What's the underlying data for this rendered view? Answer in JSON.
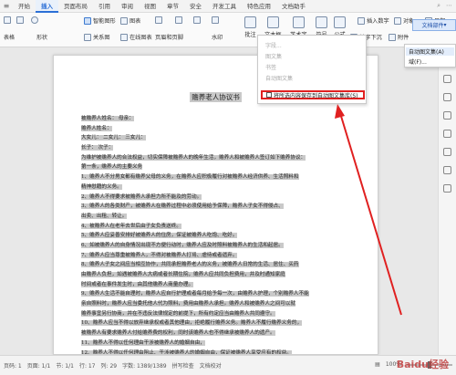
{
  "tabs": [
    "开始",
    "插入",
    "页面布局",
    "引用",
    "审阅",
    "视图",
    "章节",
    "安全",
    "开发工具",
    "特色应用",
    "文档助手"
  ],
  "active_tab_index": 1,
  "ribbon": {
    "row1": [
      "智能图形",
      "图表",
      "页眉页脚",
      "页码",
      "文本框",
      "艺术字",
      "插入数字",
      "对象",
      "日期"
    ],
    "row2": [
      "关系图",
      "在线图表",
      "页眉和页脚",
      "水印",
      "文本框",
      "首字下沉",
      "附件",
      "文档部件"
    ],
    "tall": [
      "批注",
      "文本框",
      "艺术字",
      "符号",
      "公式"
    ],
    "doc_parts_button": "文档部件"
  },
  "dropdown": {
    "items": [
      "字段...",
      "图文集",
      "书签",
      "自动图文集"
    ],
    "save_selection": "将所选内容保存到自动图文集库(S)"
  },
  "submenu": {
    "items": [
      "自动图文集(A)",
      "域(F)..."
    ]
  },
  "document": {
    "title": "赡养老人协议书",
    "lines": [
      "被赡养人姓名：  母亲：",
      "赡养人姓名：",
      "    大女儿：  二女儿：  三女儿：",
      "    长子：    次子：",
      "    为维护被赡养人的合法权益，切实保障被赡养人的晚年生活，赡养人和被赡养人签订如下赡养协议：",
      "    第一条，赡养人的主要义务",
      "    1、赡养人不分男女都有赡养父母的义务，在赡养人应积极履行对被赡养人经济供养、生活照料和",
      "精神慰藉的义务。",
      "    2、赡养人不得要求被赡养人承担力所不能及的劳动。",
      "    3、赡养人的各类财产，被赡养人在赡养过程中必须使用给予保障，赡养人子女不得侵占、",
      "出卖、出租、转让。",
      "    4、被赡养人在老年去世后由子女负责送终。",
      "    5、赡养人应妥善安排好被赡养人的住房，保证被赡养人吃饱、吃好。",
      "    6、如被赡养人的自身情况出现不方便行动时，赡养人应及时照料被赡养人的生活和起居。",
      "    7、赡养人应当尊重被赡养人，不得对被赡养人打骂、虐待或者遗弃。",
      "    8、赡养人子女之间应当相互协作，共同承担赡养老人的义务，被赡养人日常的生活、居住、买药",
      "由赡养人负担，如遇被赡养人大病或者长期住院，赡养人应共同负担费用，并及时通知家庭",
      "时间或者在事件发生时，由其他赡养人商量办理。",
      "    9、赡养人生活不能自理时，赡养人应自行护理或者每月给予每一次，由赡养人护理，个别赡养人不能",
      "亲自照料时，赡养人应当委托他人代为照料，费用由赡养人承担。赡养人和被赡养人之间可以就",
      "赡养事宜另行协商，并在不违反法律规定的前提下，所有约定应当由赡养人共同遵守。",
      "    10、赡养人应当不得以放弃继承权或者其他理由，拒绝履行赡养义务。赡养人不履行赡养义务的，",
      "被赡养人有要求赡养人付给赡养费的权利，同时该赡养人也不得继承被赡养人的遗产。",
      "    11、赡养人不得以任何理由干涉被赡养人的婚姻自由，",
      "    12、赡养人不得以任何理由阻止、干涉被赡养人的婚姻自由，保证被赡养人享受应有的权益。",
      "    第二条，赡养费的支付、期限",
      "    1、赡养老人费用由赡养人共同分担，被赡养人自主支配，按月给付。"
    ]
  },
  "status": {
    "page": "页码: 1",
    "pages": "页面: 1/1",
    "section": "节: 1/1",
    "row": "行: 17",
    "col": "列: 29",
    "wordcount": "字数: 1389/1389",
    "spellcheck": "拼写检查",
    "doc_check": "文档校对",
    "zoom": "100%"
  },
  "watermark_text": "Baidu经验"
}
